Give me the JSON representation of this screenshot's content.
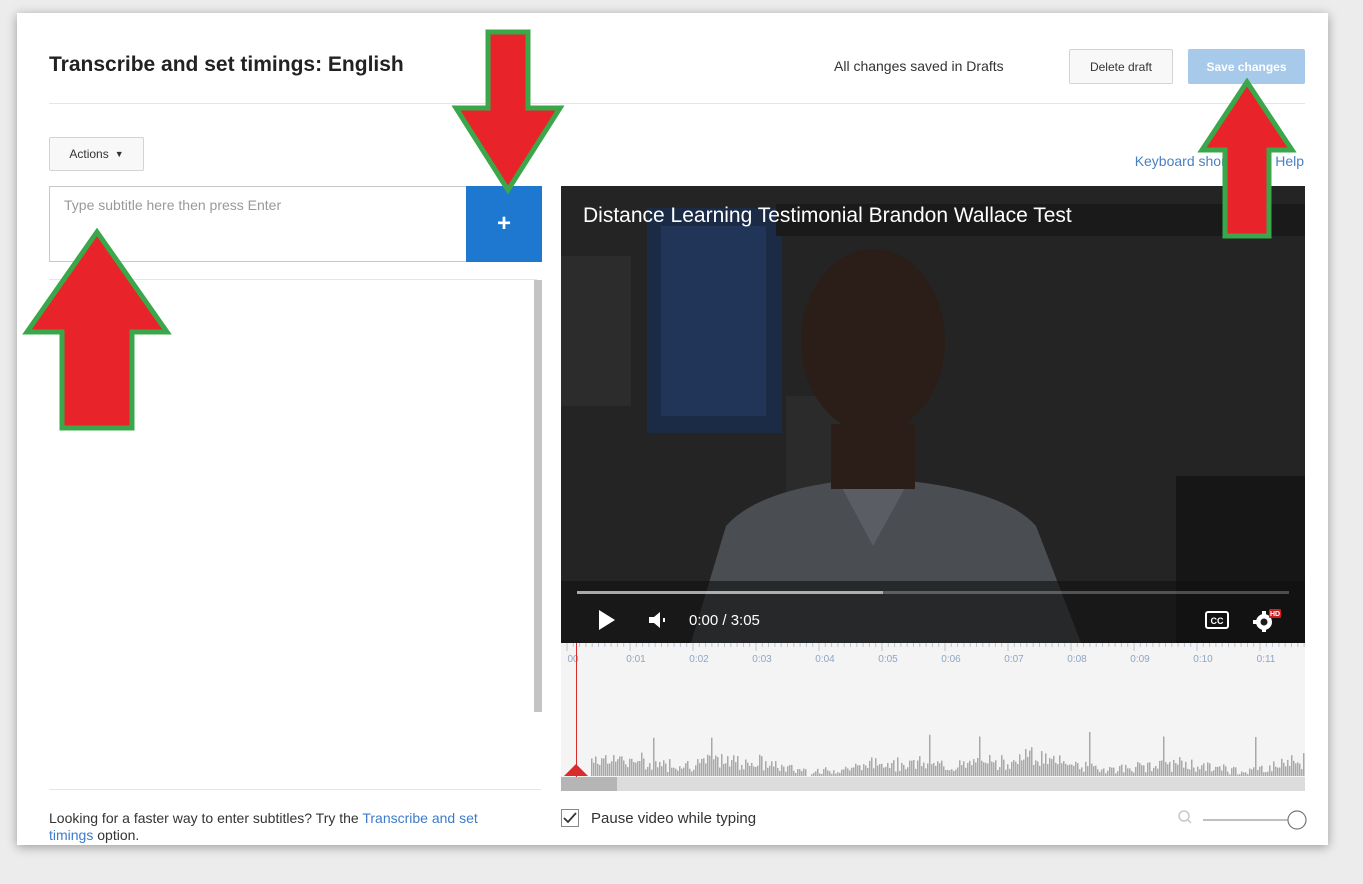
{
  "header": {
    "title": "Transcribe and set timings: English",
    "saved_status": "All changes saved in Drafts",
    "delete_draft_label": "Delete draft",
    "save_changes_label": "Save changes"
  },
  "toolbar": {
    "actions_label": "Actions"
  },
  "help_links": {
    "keyboard_shortcuts": "Keyboard shortcuts",
    "help": "Help"
  },
  "editor": {
    "input_placeholder": "Type subtitle here then press Enter",
    "add_button_label": "+"
  },
  "player": {
    "video_title": "Distance Learning Testimonial Brandon Wallace Test",
    "time_readout": "0:00 / 3:05",
    "progress_loaded": 0.43,
    "cc_label": "CC",
    "hd_badge": "HD"
  },
  "timeline": {
    "tick_labels": [
      "00",
      "0:01",
      "0:02",
      "0:03",
      "0:04",
      "0:05",
      "0:06",
      "0:07",
      "0:08",
      "0:09",
      "0:10",
      "0:11"
    ]
  },
  "options": {
    "pause_while_typing_label": "Pause video while typing",
    "pause_while_typing_checked": true
  },
  "footer": {
    "hint_prefix": "Looking for a faster way to enter subtitles? Try the ",
    "hint_link": "Transcribe and set timings",
    "hint_suffix": " option."
  },
  "colors": {
    "primary_blue": "#1f78cf",
    "save_button_disabled": "#a7c9ea",
    "link_blue": "#3d7cc9",
    "playhead_red": "#d92b2b",
    "arrow_red": "#e8232a",
    "arrow_outline_green": "#3aa84a"
  },
  "annotations": {
    "arrows": [
      {
        "points_to": "add-button",
        "direction": "down"
      },
      {
        "points_to": "save-changes-button",
        "direction": "up"
      },
      {
        "points_to": "subtitle-input",
        "direction": "up"
      }
    ]
  }
}
